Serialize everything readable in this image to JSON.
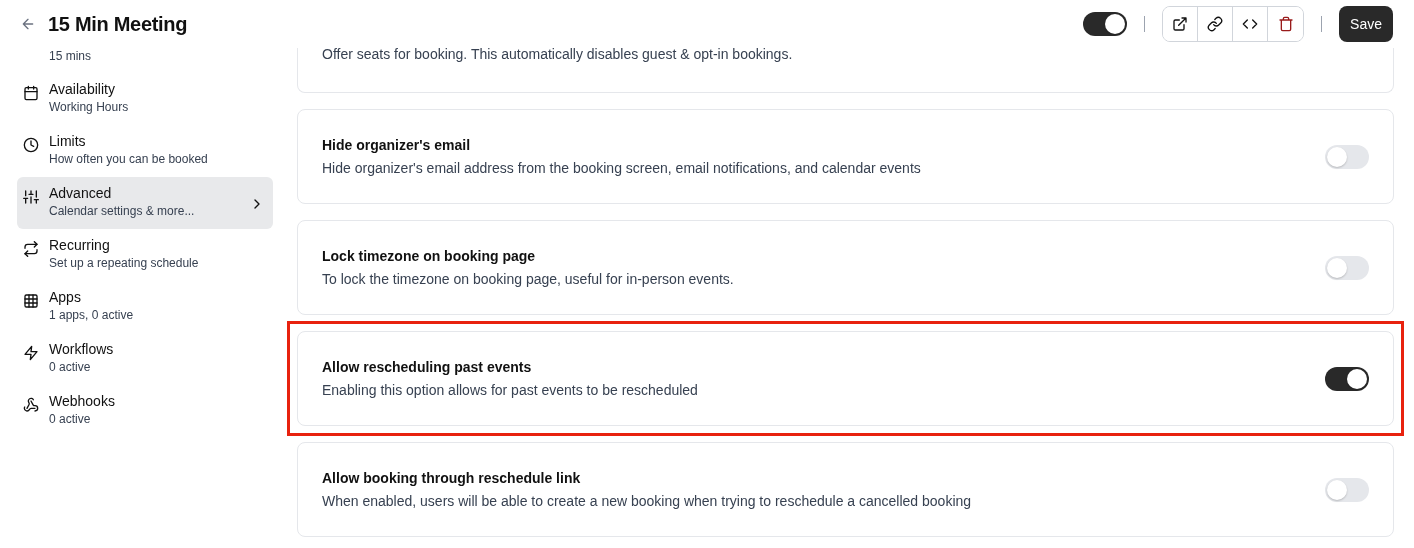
{
  "header": {
    "title": "15 Min Meeting",
    "hidden_toggle": {
      "on": true
    },
    "actions": [
      {
        "kind": "external"
      },
      {
        "kind": "link"
      },
      {
        "kind": "embed"
      },
      {
        "kind": "delete"
      }
    ],
    "save_label": "Save"
  },
  "sidebar": {
    "items": [
      {
        "subtitle": "15 mins",
        "selected": false
      },
      {
        "kind": "calendar",
        "title": "Availability",
        "subtitle": "Working Hours",
        "selected": false
      },
      {
        "kind": "clock",
        "title": "Limits",
        "subtitle": "How often you can be booked",
        "selected": false
      },
      {
        "kind": "sliders",
        "title": "Advanced",
        "subtitle": "Calendar settings & more...",
        "selected": true
      },
      {
        "kind": "repeat",
        "title": "Recurring",
        "subtitle": "Set up a repeating schedule",
        "selected": false
      },
      {
        "kind": "grid",
        "title": "Apps",
        "subtitle": "1 apps, 0 active",
        "selected": false
      },
      {
        "kind": "bolt",
        "title": "Workflows",
        "subtitle": "0 active",
        "selected": false
      },
      {
        "kind": "webhook",
        "title": "Webhooks",
        "subtitle": "0 active",
        "selected": false
      }
    ]
  },
  "settings": [
    {
      "description": "Offer seats for booking. This automatically disables guest & opt-in bookings.",
      "highlighted": false
    },
    {
      "title": "Hide organizer's email",
      "description": "Hide organizer's email address from the booking screen, email notifications, and calendar events",
      "on": false,
      "highlighted": false
    },
    {
      "title": "Lock timezone on booking page",
      "description": "To lock the timezone on booking page, useful for in-person events.",
      "on": false,
      "highlighted": false
    },
    {
      "title": "Allow rescheduling past events",
      "description": "Enabling this option allows for past events to be rescheduled",
      "on": true,
      "highlighted": true
    },
    {
      "title": "Allow booking through reschedule link",
      "description": "When enabled, users will be able to create a new booking when trying to reschedule a cancelled booking",
      "on": false,
      "highlighted": false
    }
  ]
}
